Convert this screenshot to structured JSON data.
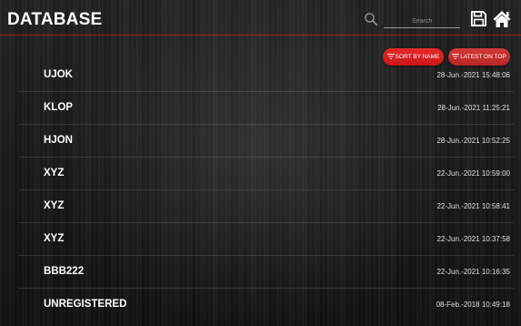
{
  "header": {
    "title": "DATABASE",
    "search_placeholder": "Search"
  },
  "sort": {
    "by_name_label": "SORT BY NAME",
    "latest_label": "LATEST ON TOP"
  },
  "records": [
    {
      "name": "UJOK",
      "date": "28-Jun.-2021 15:48:06"
    },
    {
      "name": "KLOP",
      "date": "28-Jun.-2021 11:25:21"
    },
    {
      "name": "HJON",
      "date": "28-Jun.-2021 10:52:25"
    },
    {
      "name": "XYZ",
      "date": "22-Jun.-2021 10:59:00"
    },
    {
      "name": "XYZ",
      "date": "22-Jun.-2021 10:58:41"
    },
    {
      "name": "XYZ",
      "date": "22-Jun.-2021 10:37:58"
    },
    {
      "name": "BBB222",
      "date": "22-Jun.-2021 10:16:35"
    },
    {
      "name": "UNREGISTERED",
      "date": "08-Feb.-2018 10:49:18"
    }
  ],
  "icons": {
    "search": "search-icon",
    "save": "save-icon",
    "home": "home-icon",
    "filter": "filter-icon"
  },
  "colors": {
    "accent": "#d42020",
    "header_line": "#b21a1a",
    "text": "#ffffff"
  }
}
